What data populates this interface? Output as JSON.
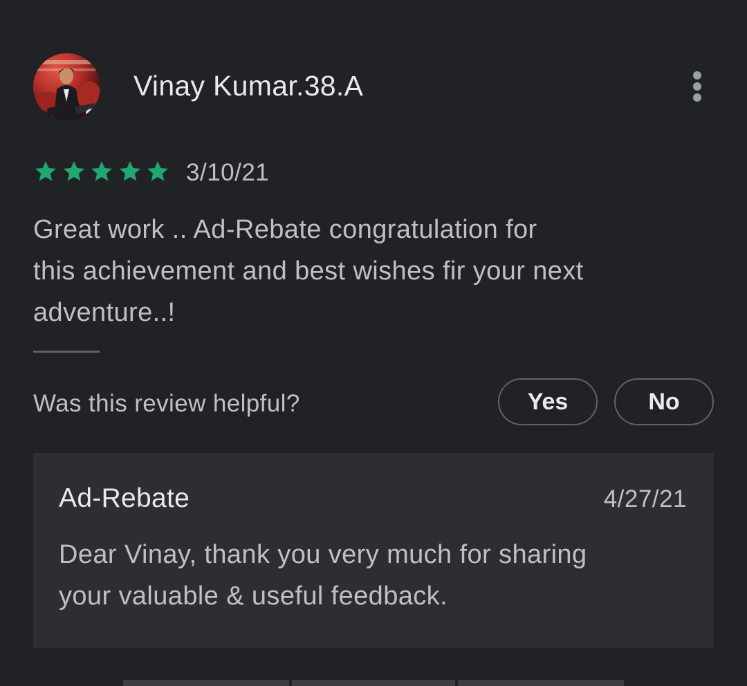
{
  "review": {
    "reviewer_name": "Vinay Kumar.38.A",
    "avatar_icon": "user-avatar-photo",
    "more_icon": "more-vert-icon",
    "rating": 5,
    "rating_max": 5,
    "star_color": "#1fa76f",
    "date": "3/10/21",
    "text_lines": [
      "Great work .. Ad-Rebate congratulation for",
      "this achievement and best wishes fir your next",
      "adventure..!"
    ]
  },
  "helpful": {
    "question": "Was this review helpful?",
    "yes_label": "Yes",
    "no_label": "No"
  },
  "developer_reply": {
    "developer_name": "Ad-Rebate",
    "date": "4/27/21",
    "text_lines": [
      "Dear Vinay, thank you very much for sharing",
      "your valuable & useful feedback."
    ]
  },
  "colors": {
    "background": "#212225",
    "reply_background": "#2d2e31",
    "primary_text": "#e8eaed",
    "secondary_text": "#bdc1c6",
    "outline": "#5f6368"
  }
}
